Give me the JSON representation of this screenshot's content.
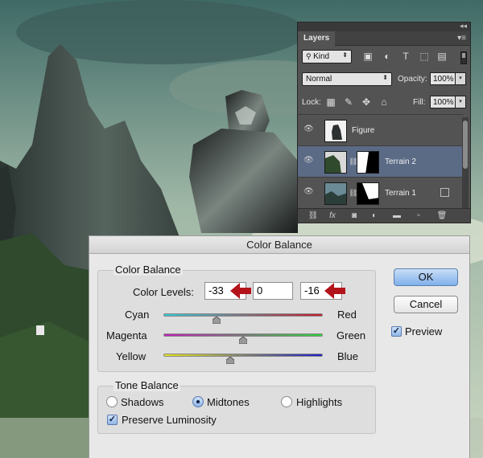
{
  "layers_panel": {
    "tab_label": "Layers",
    "collapse_glyph": "◂◂",
    "menu_glyph": "▾≡",
    "filter_kind": "Kind",
    "filter_icons": [
      "image-filter-icon",
      "adjustment-filter-icon",
      "type-filter-icon",
      "shape-filter-icon",
      "smart-object-filter-icon"
    ],
    "blend_mode": "Normal",
    "opacity_label": "Opacity:",
    "opacity_value": "100%",
    "lock_label": "Lock:",
    "fill_label": "Fill:",
    "fill_value": "100%",
    "layers": [
      {
        "name": "Figure",
        "selected": false
      },
      {
        "name": "Terrain 2",
        "selected": true
      },
      {
        "name": "Terrain 1",
        "selected": false
      }
    ]
  },
  "color_balance": {
    "window_title": "Color Balance",
    "group_title": "Color Balance",
    "levels_label": "Color Levels:",
    "levels": [
      "-33",
      "0",
      "-16"
    ],
    "sliders": [
      {
        "left": "Cyan",
        "right": "Red",
        "value": -33
      },
      {
        "left": "Magenta",
        "right": "Green",
        "value": 0
      },
      {
        "left": "Yellow",
        "right": "Blue",
        "value": -16
      }
    ],
    "tone_title": "Tone Balance",
    "tones": [
      "Shadows",
      "Midtones",
      "Highlights"
    ],
    "selected_tone": "Midtones",
    "preserve_label": "Preserve Luminosity",
    "preserve_checked": true,
    "ok_label": "OK",
    "cancel_label": "Cancel",
    "preview_label": "Preview",
    "preview_checked": true
  },
  "colors": {
    "arrow_red": "#b3141b",
    "selected_layer": "#5b6b86",
    "panel_bg": "#535353"
  }
}
